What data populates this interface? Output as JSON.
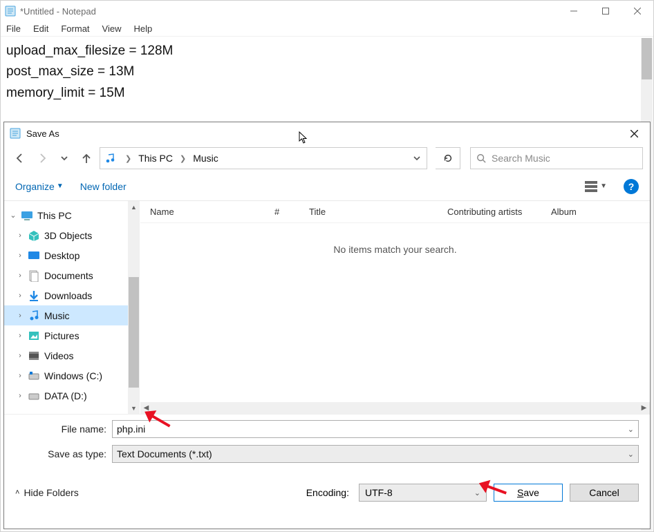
{
  "notepad": {
    "title": "*Untitled - Notepad",
    "menu": [
      "File",
      "Edit",
      "Format",
      "View",
      "Help"
    ],
    "lines": [
      "upload_max_filesize = 128M",
      "post_max_size = 13M",
      "memory_limit = 15M"
    ]
  },
  "dialog": {
    "title": "Save As",
    "breadcrumb": {
      "p1": "This PC",
      "p2": "Music"
    },
    "search_placeholder": "Search Music",
    "toolbar": {
      "organize": "Organize",
      "newfolder": "New folder"
    },
    "tree": {
      "root": "This PC",
      "items": [
        "3D Objects",
        "Desktop",
        "Documents",
        "Downloads",
        "Music",
        "Pictures",
        "Videos",
        "Windows (C:)",
        "DATA (D:)"
      ],
      "selected_index": 4
    },
    "columns": {
      "name": "Name",
      "num": "#",
      "title": "Title",
      "contrib": "Contributing artists",
      "album": "Album"
    },
    "empty": "No items match your search.",
    "filename_label": "File name:",
    "filename_value": "php.ini",
    "type_label": "Save as type:",
    "type_value": "Text Documents (*.txt)",
    "encoding_label": "Encoding:",
    "encoding_value": "UTF-8",
    "hide_folders": "Hide Folders",
    "save": "Save",
    "cancel": "Cancel",
    "help_glyph": "?"
  }
}
